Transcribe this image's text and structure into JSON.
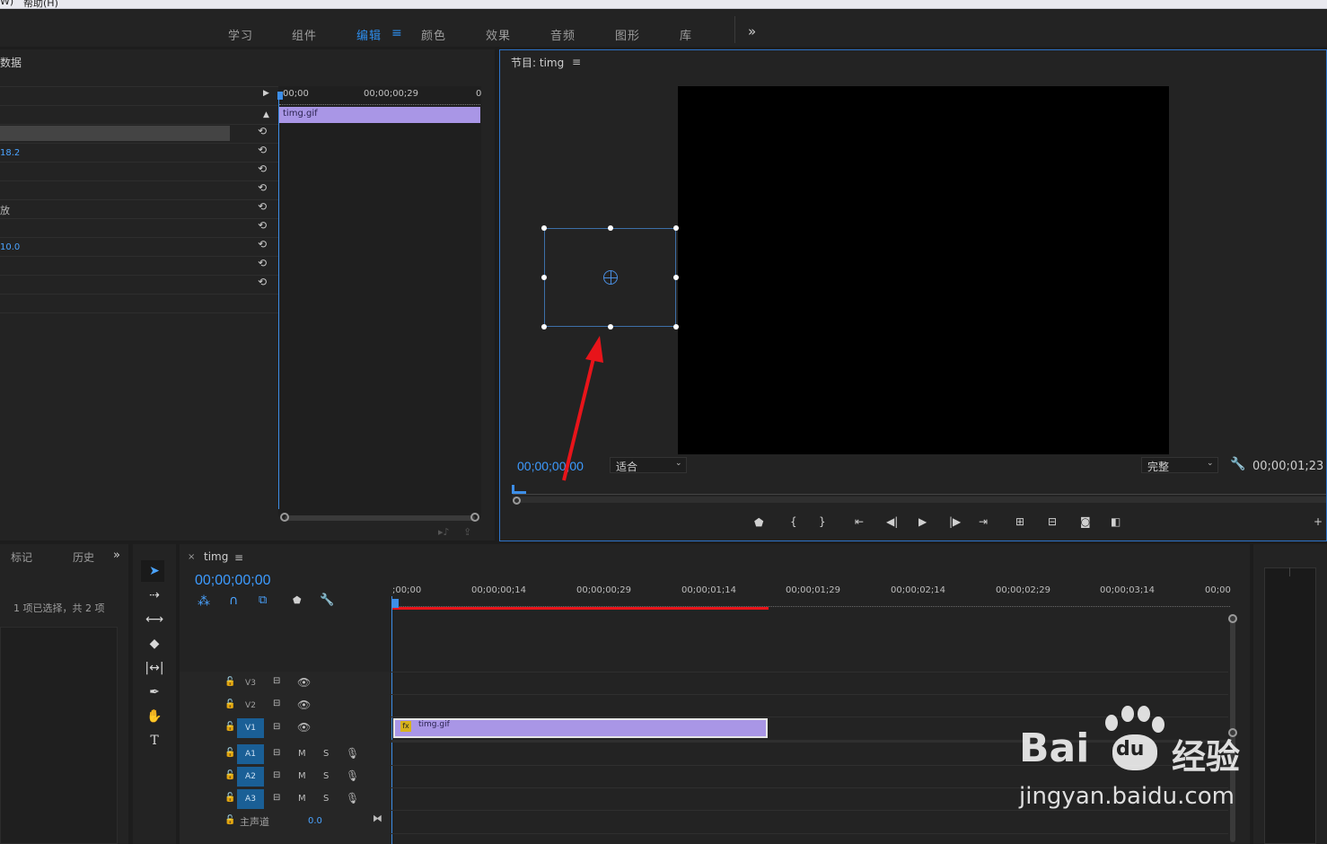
{
  "menubar": {
    "items": [
      "W)",
      "帮助(H)"
    ]
  },
  "workspace": {
    "tabs": [
      "学习",
      "组件",
      "编辑",
      "颜色",
      "效果",
      "音频",
      "图形",
      "库"
    ],
    "active": "编辑",
    "more": "»"
  },
  "effect_controls": {
    "title_fragment": "数据",
    "ruler_times": [
      "00;00",
      "00;00;00;29",
      "0"
    ],
    "clip_name": "timg.gif",
    "values": [
      "18.2",
      "10.0"
    ],
    "labels": [
      "放"
    ]
  },
  "program_monitor": {
    "title": "节目: timg",
    "current_time": "00;00;00;00",
    "fit_select": "适合",
    "quality_select": "完整",
    "duration": "00;00;01;23"
  },
  "project_panel": {
    "tabs": [
      "标记",
      "历史"
    ],
    "selection_info": "1 项已选择，共 2 项"
  },
  "timeline": {
    "sequence_name": "timg",
    "current_time": "00;00;00;00",
    "ruler_times": [
      ";00;00",
      "00;00;00;14",
      "00;00;00;29",
      "00;00;01;14",
      "00;00;01;29",
      "00;00;02;14",
      "00;00;02;29",
      "00;00;03;14",
      "00;00"
    ],
    "video_tracks": [
      "V3",
      "V2",
      "V1"
    ],
    "audio_tracks": [
      "A1",
      "A2",
      "A3"
    ],
    "master_label": "主声道",
    "master_value": "0.0",
    "clip_name": "timg.gif",
    "clip_fx": "fx",
    "mute": "M",
    "solo": "S"
  },
  "watermark": {
    "brand": "Bai",
    "brand2": "经验",
    "url": "jingyan.baidu.com"
  },
  "colors": {
    "accent_blue": "#2d8ceb",
    "clip_purple": "#a996e6",
    "annotation_red": "#e8141a"
  }
}
